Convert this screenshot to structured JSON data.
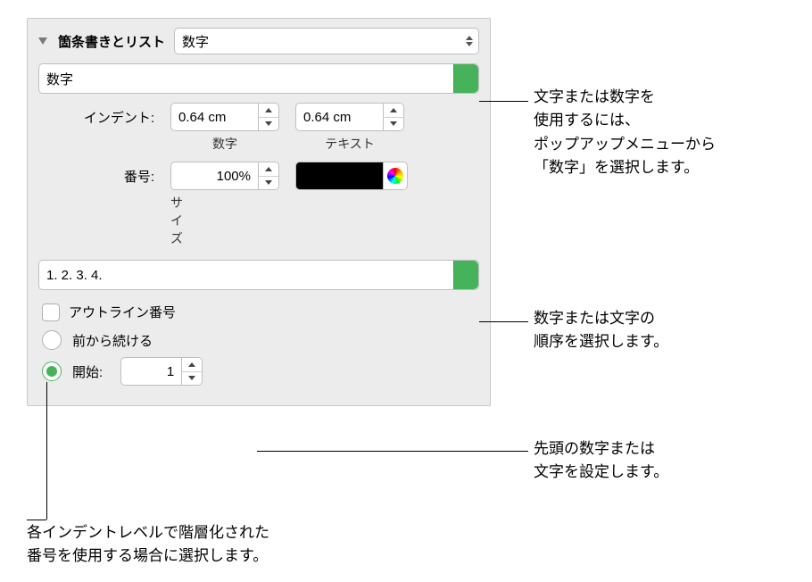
{
  "header": {
    "title": "箇条書きとリスト",
    "style_selector": "数字"
  },
  "type_popup": "数字",
  "indent": {
    "label": "インデント:",
    "number_value": "0.64 cm",
    "number_sublabel": "数字",
    "text_value": "0.64 cm",
    "text_sublabel": "テキスト"
  },
  "number": {
    "label": "番号:",
    "size_value": "100%",
    "size_sublabel": "サイズ"
  },
  "format_popup": "1. 2. 3. 4.",
  "outline_checkbox": "アウトライン番号",
  "continue_radio": "前から続ける",
  "start_radio": {
    "label": "開始:",
    "value": "1"
  },
  "callouts": {
    "c1": "文字または数字を\n使用するには、\nポップアップメニューから\n「数字」を選択します。",
    "c2": "数字または文字の\n順序を選択します。",
    "c3": "先頭の数字または\n文字を設定します。",
    "c4": "各インデントレベルで階層化された\n番号を使用する場合に選択します。"
  }
}
